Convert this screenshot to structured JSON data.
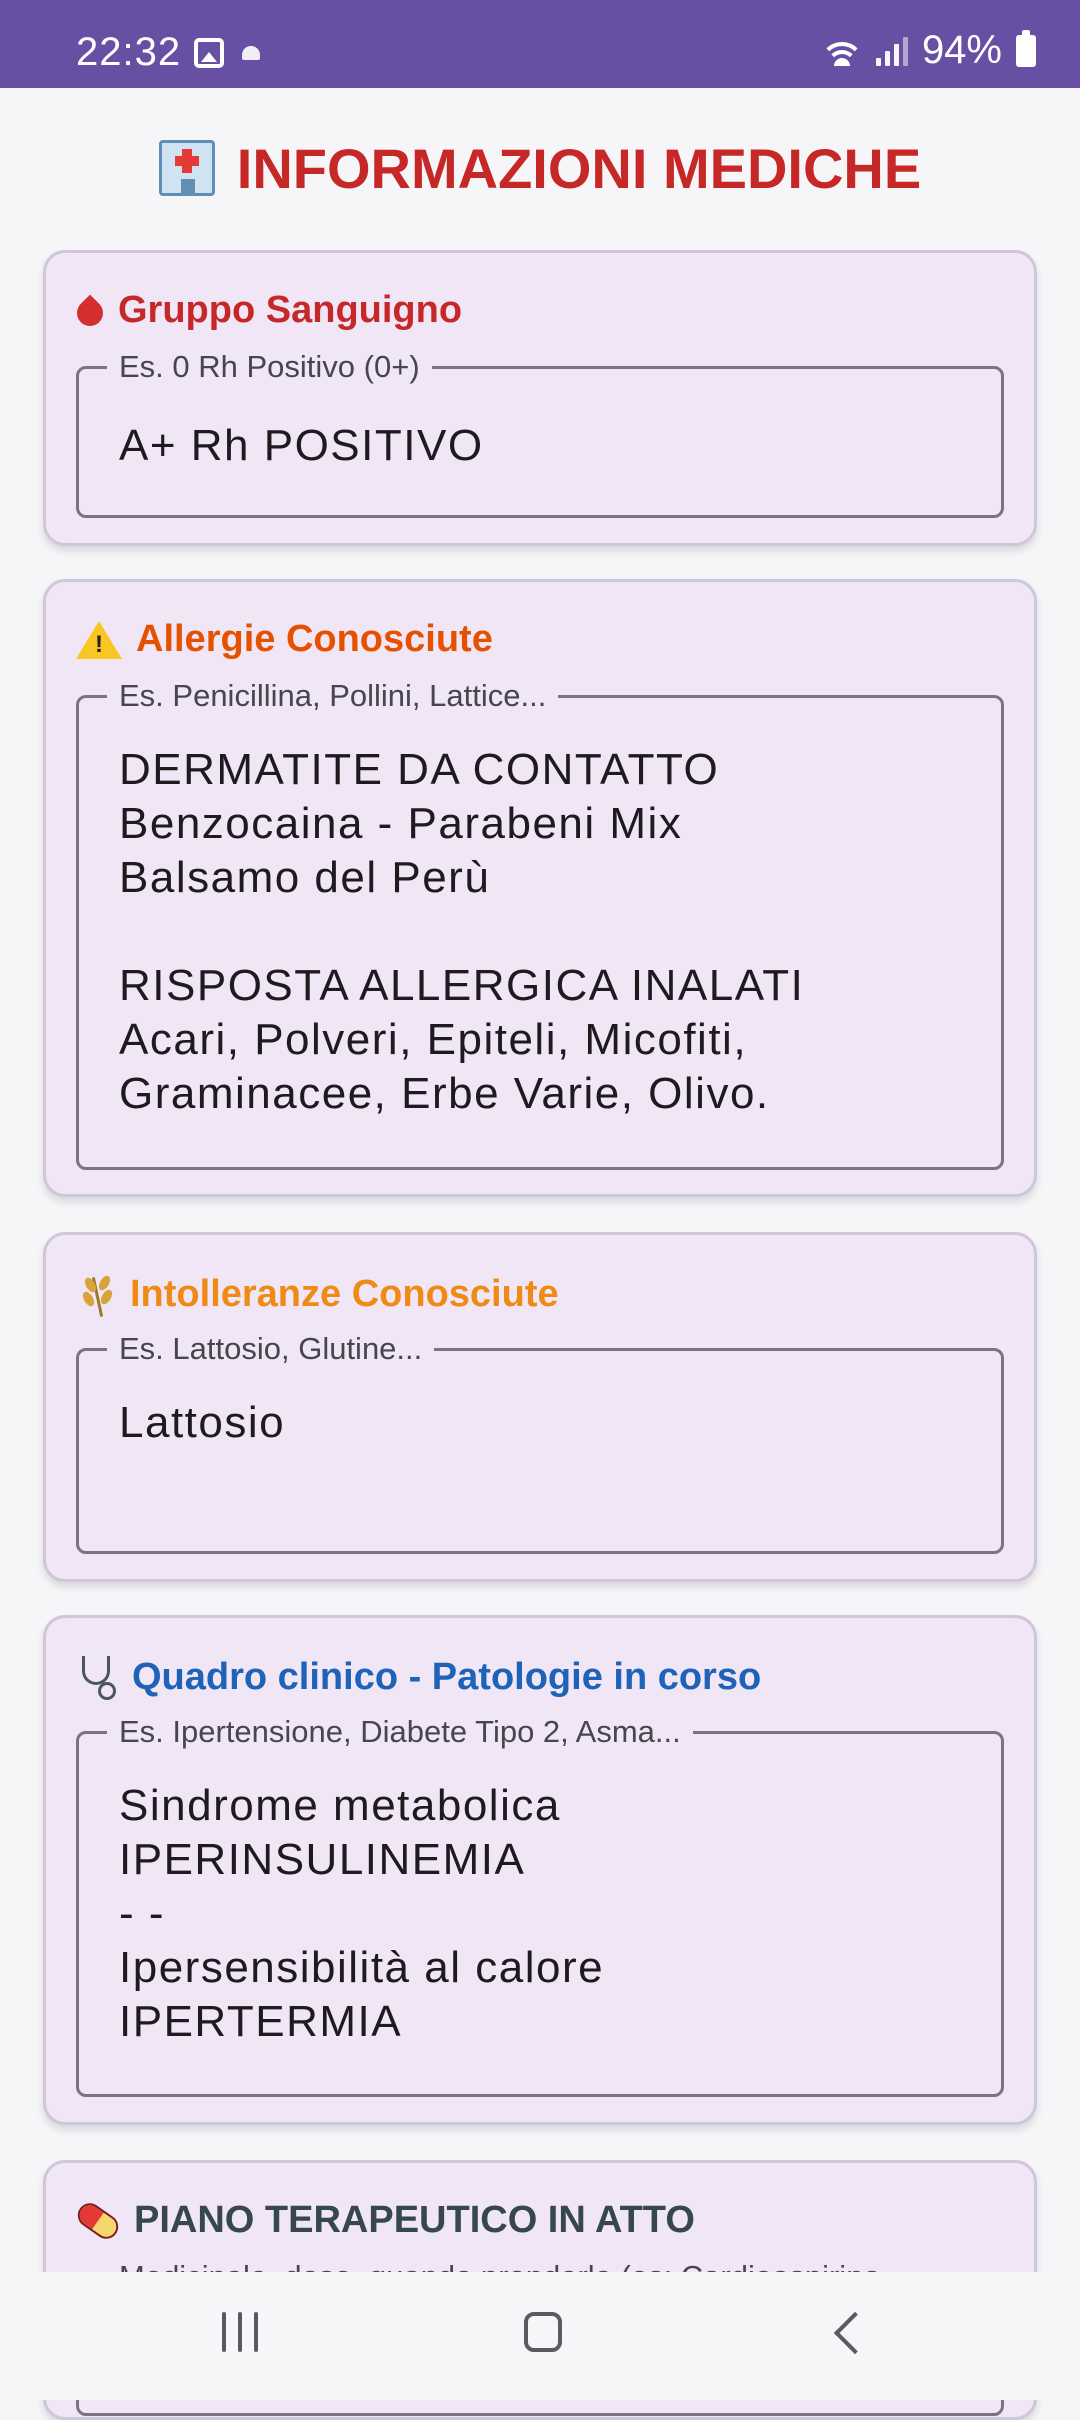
{
  "status_bar": {
    "time": "22:32",
    "battery_percent": "94%",
    "icons": [
      "gallery-icon",
      "notification-dot-icon",
      "wifi-icon",
      "signal-icon",
      "battery-icon"
    ]
  },
  "page": {
    "title": "INFORMAZIONI MEDICHE",
    "title_icon": "hospital-icon",
    "title_color": "#c62828"
  },
  "sections": {
    "blood": {
      "title": "Gruppo Sanguigno",
      "icon": "blood-drop-icon",
      "color": "#c62828",
      "placeholder": "Es. 0 Rh Positivo (0+)",
      "value": "A+ Rh POSITIVO"
    },
    "allergies": {
      "title": "Allergie Conosciute",
      "icon": "warning-icon",
      "color": "#e65100",
      "placeholder": "Es. Penicillina, Pollini, Lattice...",
      "value": "DERMATITE DA CONTATTO\nBenzocaina - Parabeni Mix\nBalsamo del Perù\n\nRISPOSTA ALLERGICA INALATI\nAcari, Polveri, Epiteli, Micofiti,\nGraminacee, Erbe Varie, Olivo."
    },
    "intolerances": {
      "title": "Intolleranze Conosciute",
      "icon": "grain-icon",
      "color": "#ef8a17",
      "placeholder": "Es. Lattosio, Glutine...",
      "value": "Lattosio"
    },
    "clinical": {
      "title": "Quadro clinico - Patologie in corso",
      "icon": "stethoscope-icon",
      "color": "#1e63b8",
      "placeholder": "Es. Ipertensione, Diabete Tipo 2, Asma...",
      "value": "Sindrome metabolica\nIPERINSULINEMIA\n- -\nIpersensibilità al calore\nIPERTERMIA"
    },
    "therapy": {
      "title": "PIANO TERAPEUTICO IN ATTO",
      "icon": "pill-icon",
      "color": "#37474f",
      "placeholder": "Medicinale, dose, quando prenderlo (es: Cardioaspirina..."
    }
  },
  "nav_bar": {
    "icons": [
      "recents-icon",
      "home-icon",
      "back-icon"
    ]
  }
}
